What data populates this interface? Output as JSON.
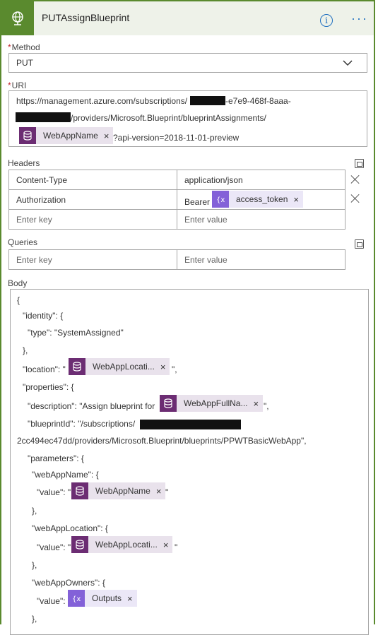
{
  "header": {
    "title": "PUTAssignBlueprint",
    "info_icon": "info-icon",
    "more_icon": "more-icon"
  },
  "method": {
    "label": "Method",
    "value": "PUT"
  },
  "uri": {
    "label": "URI",
    "line1_prefix": "https://management.azure.com/subscriptions/",
    "line1_suffix": "-e7e9-468f-8aaa-",
    "line2_suffix": "/providers/Microsoft.Blueprint/blueprintAssignments/",
    "token": "WebAppName",
    "line3_suffix": "?api-version=2018-11-01-preview"
  },
  "headers": {
    "label": "Headers",
    "rows": [
      {
        "key": "Content-Type",
        "value": "application/json"
      },
      {
        "key": "Authorization",
        "value_prefix": "Bearer",
        "value_token": "access_token"
      }
    ],
    "key_placeholder": "Enter key",
    "value_placeholder": "Enter value"
  },
  "queries": {
    "label": "Queries",
    "key_placeholder": "Enter key",
    "value_placeholder": "Enter value"
  },
  "body": {
    "label": "Body",
    "l_open": "{",
    "l_identity": "\"identity\": {",
    "l_type": "\"type\": \"SystemAssigned\"",
    "l_close1": "},",
    "l_location_pre": "\"location\": \"",
    "tok_location": "WebAppLocati...",
    "l_location_post": "\",",
    "l_properties": "\"properties\": {",
    "l_desc_pre": "\"description\": \"Assign blueprint for",
    "tok_fullname": "WebAppFullNa...",
    "l_desc_post": "\",",
    "l_bpid_pre": "\"blueprintId\": \"/subscriptions/",
    "l_bpid_cont": "2cc494ec47dd/providers/Microsoft.Blueprint/blueprints/PPWTBasicWebApp\",",
    "l_parameters": "\"parameters\": {",
    "l_wan": "\"webAppName\": {",
    "l_value_pre": "\"value\": \"",
    "tok_name": "WebAppName",
    "l_quote": "\"",
    "l_close2": "},",
    "l_wal": "\"webAppLocation\": {",
    "tok_location2": "WebAppLocati...",
    "l_close3": "},",
    "l_wao": "\"webAppOwners\": {",
    "l_value_plain": "\"value\":",
    "tok_outputs": "Outputs",
    "l_close4": "},"
  },
  "colors": {
    "accent": "#5a8a2e",
    "db_token": "#6c2d73",
    "var_token": "#8361d8",
    "link": "#1f6fc0"
  }
}
